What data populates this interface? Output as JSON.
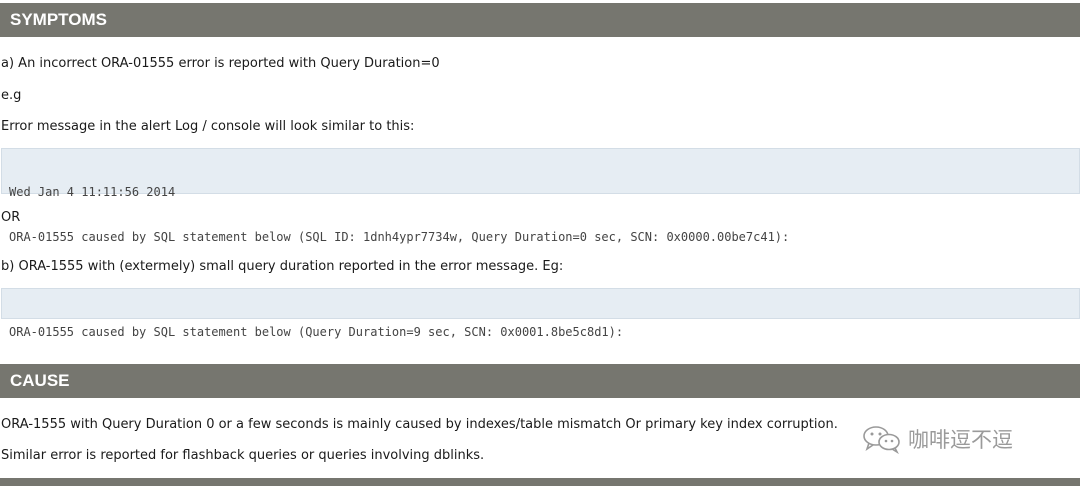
{
  "symptoms": {
    "title": "SYMPTOMS",
    "line_a": "a) An incorrect ORA-01555 error is reported with Query Duration=0",
    "eg": "e.g",
    "error_intro": "Error message in the alert Log / console will look similar to this:",
    "code_block_1": [
      "Wed Jan 4 11:11:56 2014",
      "ORA-01555 caused by SQL statement below (SQL ID: 1dnh4ypr7734w, Query Duration=0 sec, SCN: 0x0000.00be7c41):"
    ],
    "or": "OR",
    "line_b": "b) ORA-1555 with (extermely) small query duration reported in the error message. Eg:",
    "code_block_2": [
      "ORA-01555 caused by SQL statement below (Query Duration=9 sec, SCN: 0x0001.8be5c8d1):"
    ]
  },
  "cause": {
    "title": "CAUSE",
    "line_1": "ORA-1555 with Query Duration 0 or a few seconds  is mainly caused by indexes/table mismatch  Or primary key index corruption.",
    "line_2": "Similar error is reported for flashback queries or queries involving dblinks."
  },
  "watermark": {
    "icon": "wechat-icon",
    "text": "咖啡逗不逗"
  }
}
